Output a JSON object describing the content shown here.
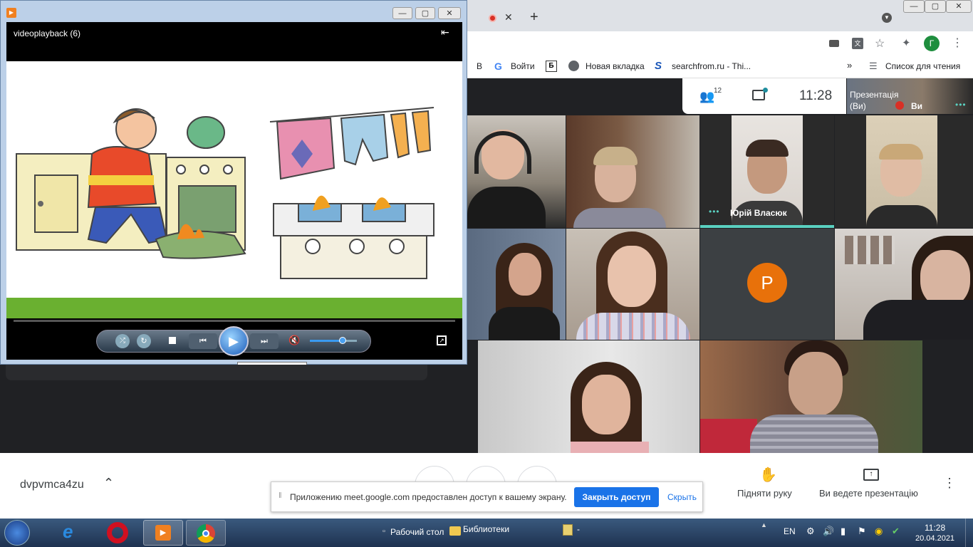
{
  "browser": {
    "bookmarks": [
      {
        "label": "В"
      },
      {
        "label": "Войти"
      },
      {
        "label": "Новая вкладка"
      },
      {
        "label": "searchfrom.ru - Thi..."
      }
    ],
    "reading_list": "Список для чтения",
    "profile_initial": "Г",
    "more": "»"
  },
  "meet": {
    "participants_count": "12",
    "time": "11:28",
    "presentation_label_1": "Презентація",
    "presentation_label_2": "(Ви)",
    "presentation_you": "Ви",
    "named_tile": "Юрій Власюк",
    "avatar_letter": "Р",
    "avatar_color": "#e8710a",
    "meeting_code": "dvpvmca4zu",
    "raise_hand": "Підняти руку",
    "presenting": "Ви ведете презентацію",
    "share_notice": "Приложению meet.google.com предоставлен доступ к вашему экрану.",
    "stop_share": "Закрыть доступ",
    "hide": "Скрыть"
  },
  "player": {
    "title": "videoplayback (6)",
    "tooltip": "Воспроизводить,",
    "volume": 0.7
  },
  "taskbar": {
    "desktop": "Рабочий стол",
    "libraries": "Библиотеки",
    "dash": "-",
    "lang": "EN",
    "time": "11:28",
    "date": "20.04.2021"
  }
}
